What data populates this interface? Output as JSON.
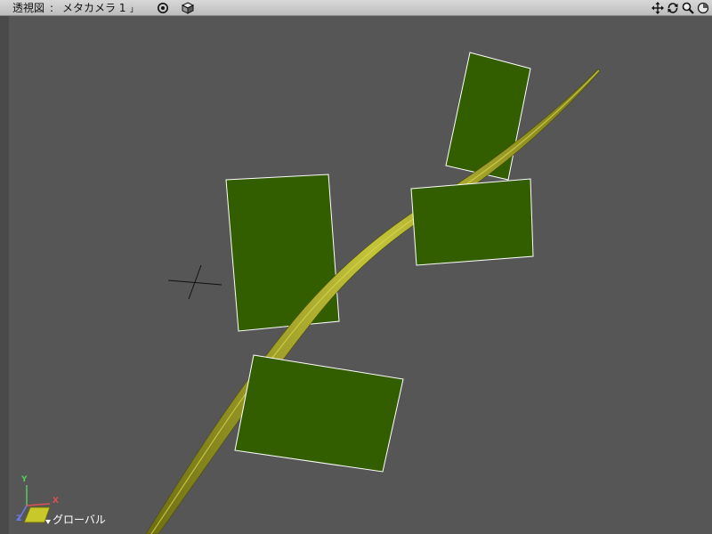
{
  "titlebar": {
    "view_name": "透視図",
    "separator": ":",
    "camera_name": "メタカメラ 1",
    "camera_dropdown_marker": "」"
  },
  "icons": {
    "target": "target-icon",
    "cube": "cube-icon",
    "pan": "move-arrows-icon",
    "rotate": "rotate-icon",
    "zoom": "magnifier-icon",
    "fit": "sphere-icon"
  },
  "viewport": {
    "coordinate_mode": "グローバル",
    "axis_labels": {
      "x": "X",
      "y": "Y",
      "z": "Z"
    }
  },
  "colors": {
    "viewport_bg": "#565656",
    "leaf_fill": "#335e00",
    "leaf_outline": "#ffffff",
    "stem": "#8a8a1a",
    "stem_highlight": "#c8c840",
    "axis_x": "#e05050",
    "axis_y": "#5ac85a",
    "axis_z": "#6a7ae8"
  }
}
